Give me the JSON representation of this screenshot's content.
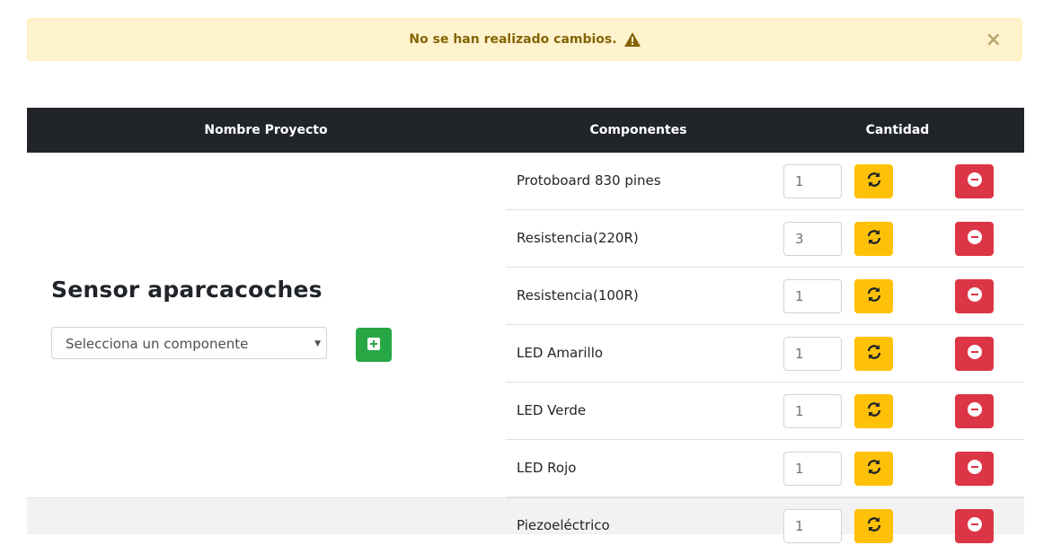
{
  "alert": {
    "message": "No se han realizado cambios.",
    "icon": "warning-triangle-icon",
    "close_label": "×",
    "color": "#856404",
    "background": "#fff3cd"
  },
  "table": {
    "headers": [
      "Nombre Proyecto",
      "Componentes",
      "Cantidad"
    ]
  },
  "project": {
    "name": "Sensor aparcacoches",
    "select_placeholder": "Selecciona un componente",
    "add_icon": "plus-square-icon"
  },
  "components": [
    {
      "name": "Protoboard 830 pines",
      "quantity": "1"
    },
    {
      "name": "Resistencia(220R)",
      "quantity": "3"
    },
    {
      "name": "Resistencia(100R)",
      "quantity": "1"
    },
    {
      "name": "LED Amarillo",
      "quantity": "1"
    },
    {
      "name": "LED Verde",
      "quantity": "1"
    },
    {
      "name": "LED Rojo",
      "quantity": "1"
    }
  ],
  "next_component": {
    "name": "Piezoeléctrico",
    "quantity": "1"
  },
  "colors": {
    "header_bg": "#212529",
    "update_button": "#ffc107",
    "remove_button": "#dc3545",
    "add_button": "#28a745"
  }
}
